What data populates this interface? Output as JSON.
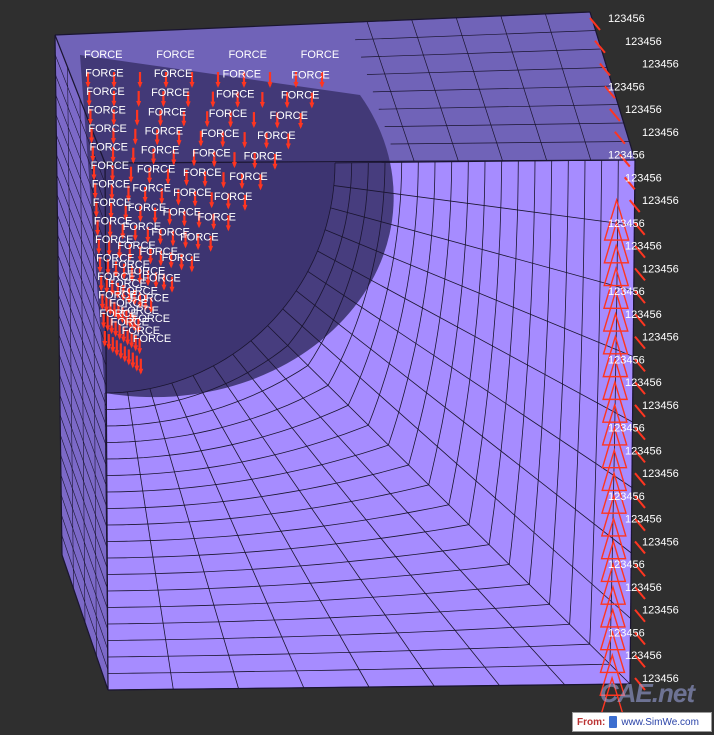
{
  "viewport": {
    "background": "#2f2f2f"
  },
  "model": {
    "front_face_color": "#a68cff",
    "top_face_color": "#7063b8",
    "side_face_color": "#7c69c8",
    "mesh_line_color": "#1a1530",
    "load_color": "#ff3520",
    "label_color": "#ffffff"
  },
  "labels": {
    "force_label": "FORCE",
    "constraint_label": "123456"
  },
  "watermark": {
    "from_text": "From:",
    "url_text": "www.SimWe.com",
    "brand_text": "CAE.net"
  }
}
